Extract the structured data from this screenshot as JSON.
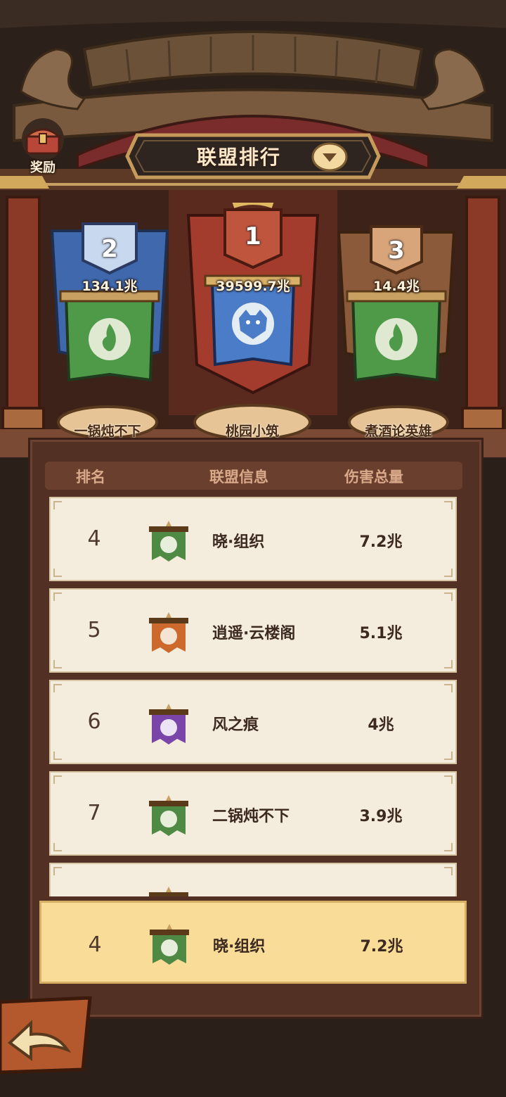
{
  "header": {
    "reward_label": "奖励",
    "title": "联盟排行",
    "title_dropdown_icon": "chevron-down-icon"
  },
  "podium": [
    {
      "rank": "2",
      "score": "134.1兆",
      "name": "一锅炖不下",
      "emblem": "flame-emblem-icon",
      "banner_color": "#4a73b8"
    },
    {
      "rank": "1",
      "score": "39599.7兆",
      "name": "桃园小筑",
      "emblem": "tiger-emblem-icon",
      "banner_color": "#a33c2c"
    },
    {
      "rank": "3",
      "score": "14.4兆",
      "name": "煮酒论英雄",
      "emblem": "flame-emblem-icon",
      "banner_color": "#8a5a3a"
    }
  ],
  "table": {
    "headers": [
      "排名",
      "联盟信息",
      "伤害总量"
    ],
    "rows": [
      {
        "rank": "4",
        "name": "晓·组织",
        "damage": "7.2兆",
        "flag_color": "#4e8a44"
      },
      {
        "rank": "5",
        "name": "逍遥·云楼阁",
        "damage": "5.1兆",
        "flag_color": "#cc6a2e"
      },
      {
        "rank": "6",
        "name": "风之痕",
        "damage": "4兆",
        "flag_color": "#7a45a8"
      },
      {
        "rank": "7",
        "name": "二锅炖不下",
        "damage": "3.9兆",
        "flag_color": "#4e8a44"
      },
      {
        "rank": "",
        "name": "",
        "damage": "",
        "flag_color": "#4e8a44"
      }
    ]
  },
  "my_alliance": {
    "rank": "4",
    "name": "晓·组织",
    "damage": "7.2兆",
    "flag_color": "#4e8a44"
  },
  "footer": {
    "back_icon": "back-arrow-icon"
  }
}
